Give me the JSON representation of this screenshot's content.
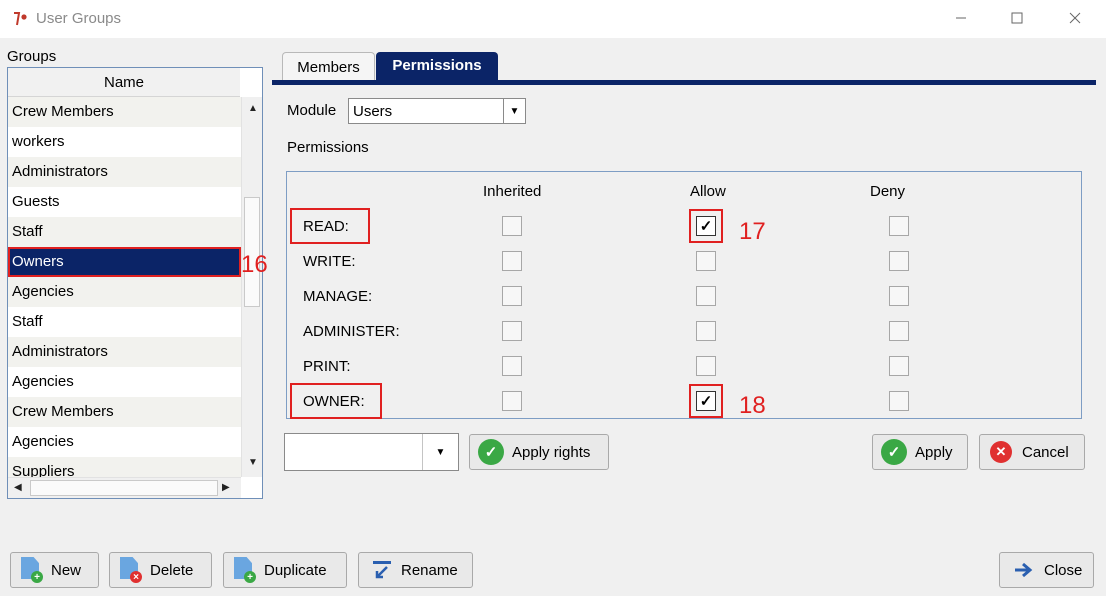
{
  "window": {
    "title": "User Groups"
  },
  "groups": {
    "label": "Groups",
    "column_header": "Name",
    "rows": [
      "Crew Members",
      "workers",
      "Administrators",
      "Guests",
      "Staff",
      "Owners",
      "Agencies",
      "Staff",
      "Administrators",
      "Agencies",
      "Crew Members",
      "Agencies",
      "Suppliers"
    ],
    "selected": "Owners",
    "annotation": "16"
  },
  "tabs": {
    "members": "Members",
    "permissions": "Permissions"
  },
  "module": {
    "label": "Module",
    "value": "Users"
  },
  "permissions": {
    "heading": "Permissions",
    "columns": {
      "inherited": "Inherited",
      "allow": "Allow",
      "deny": "Deny"
    },
    "rows": [
      {
        "label": "READ:",
        "inherited": false,
        "allow": true,
        "deny": false
      },
      {
        "label": "WRITE:",
        "inherited": false,
        "allow": false,
        "deny": false
      },
      {
        "label": "MANAGE:",
        "inherited": false,
        "allow": false,
        "deny": false
      },
      {
        "label": "ADMINISTER:",
        "inherited": false,
        "allow": false,
        "deny": false
      },
      {
        "label": "PRINT:",
        "inherited": false,
        "allow": false,
        "deny": false
      },
      {
        "label": "OWNER:",
        "inherited": false,
        "allow": true,
        "deny": false
      }
    ],
    "annotation_read": "17",
    "annotation_owner": "18"
  },
  "rights_combo": {
    "value": ""
  },
  "buttons": {
    "apply_rights": "Apply rights",
    "apply": "Apply",
    "cancel": "Cancel",
    "new": "New",
    "delete": "Delete",
    "duplicate": "Duplicate",
    "rename": "Rename",
    "close": "Close"
  },
  "icons": {
    "app": "app-logo-icon",
    "ok": "checkmark-icon",
    "cancel": "cancel-x-icon",
    "new": "new-document-icon",
    "delete": "delete-document-icon",
    "duplicate": "duplicate-document-icon",
    "rename": "rename-icon",
    "close": "arrow-right-icon"
  },
  "colors": {
    "accent": "#0b2467",
    "annotation": "#e02020",
    "ok": "#3aa845",
    "cancel": "#e03030"
  }
}
